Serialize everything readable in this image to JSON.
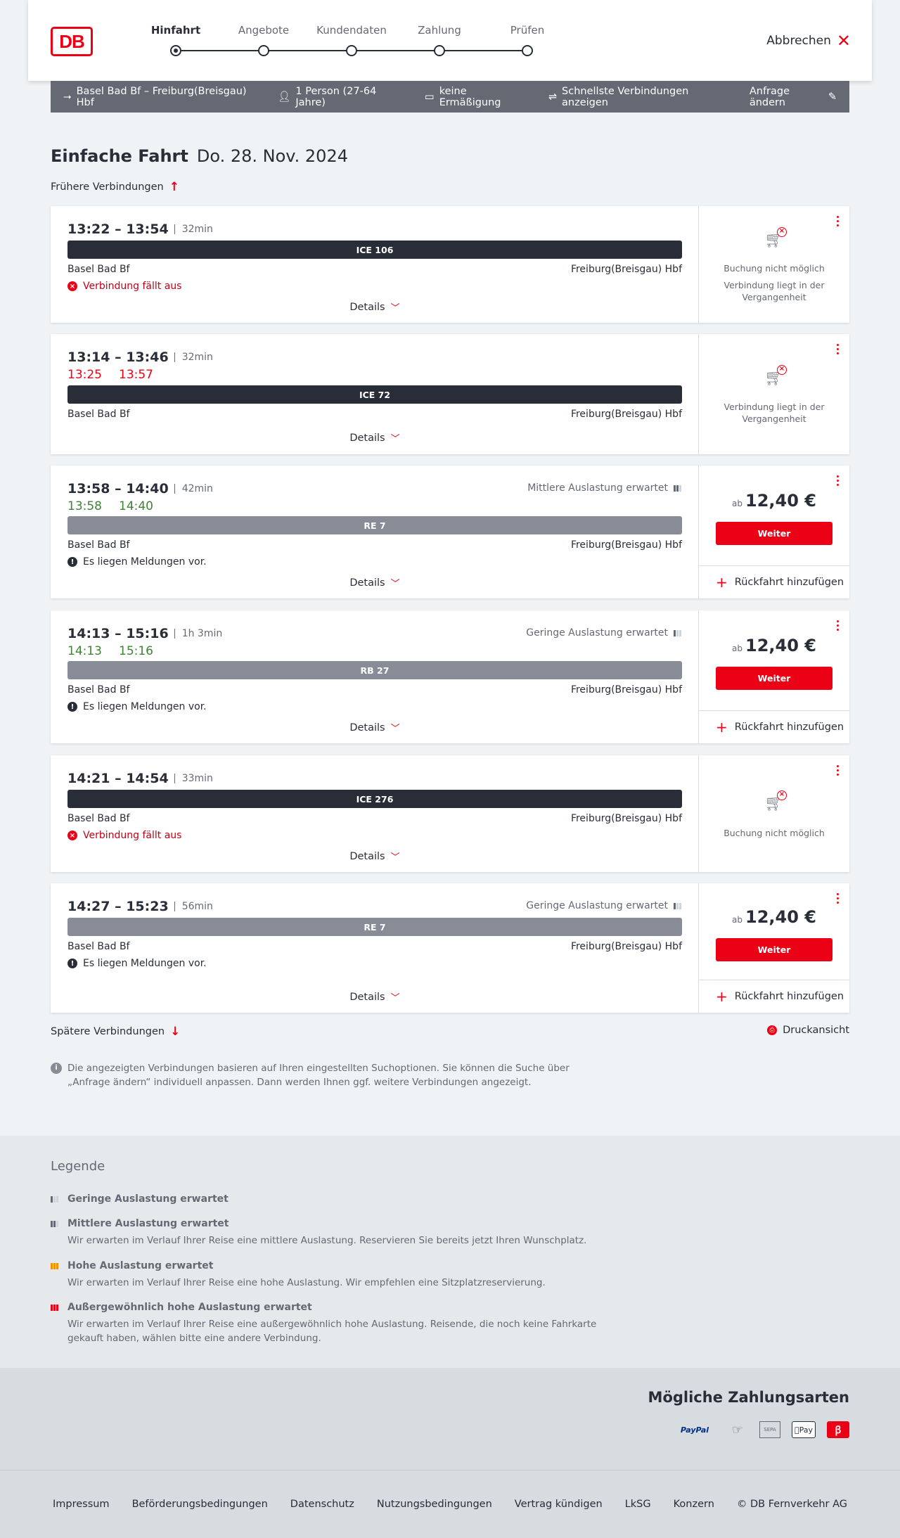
{
  "header": {
    "logo": "DB",
    "steps": [
      "Hinfahrt",
      "Angebote",
      "Kundendaten",
      "Zahlung",
      "Prüfen"
    ],
    "cancel_label": "Abbrechen"
  },
  "infobar": {
    "route": "Basel Bad Bf – Freiburg(Breisgau) Hbf",
    "passengers": "1 Person (27-64 Jahre)",
    "discount": "keine Ermäßigung",
    "fastest": "Schnellste Verbindungen anzeigen",
    "edit": "Anfrage ändern"
  },
  "main": {
    "title_bold": "Einfache Fahrt",
    "title_date": "Do. 28. Nov. 2024",
    "earlier": "Frühere Verbindungen",
    "later": "Spätere Verbindungen",
    "print": "Druckansicht",
    "note": "Die angezeigten Verbindungen basieren auf Ihren eingestellten Suchoptionen. Sie können die Suche über „Anfrage ändern“ individuell anpassen. Dann werden Ihnen ggf. weitere Verbindungen angezeigt."
  },
  "connections": [
    {
      "times": "13:22 – 13:54",
      "duration": "32min",
      "train": "ICE 106",
      "from": "Basel Bad Bf",
      "to": "Freiburg(Breisgau) Hbf",
      "message": "Verbindung fällt aus",
      "details": "Details",
      "booking": "Buchung nicht möglich",
      "past": "Verbindung liegt in der Vergangenheit"
    },
    {
      "times": "13:14 – 13:46",
      "duration": "32min",
      "rt_dep": "13:25",
      "rt_arr": "13:57",
      "train": "ICE 72",
      "from": "Basel Bad Bf",
      "to": "Freiburg(Breisgau) Hbf",
      "details": "Details",
      "past": "Verbindung liegt in der Vergangenheit"
    },
    {
      "times": "13:58 – 14:40",
      "duration": "42min",
      "rt_dep": "13:58",
      "rt_arr": "14:40",
      "train": "RE 7",
      "load": "Mittlere Auslastung erwartet",
      "from": "Basel Bad Bf",
      "to": "Freiburg(Breisgau) Hbf",
      "message": "Es liegen Meldungen vor.",
      "details": "Details",
      "price_prefix": "ab",
      "price": "12,40 €",
      "button": "Weiter",
      "return": "Rückfahrt hinzufügen"
    },
    {
      "times": "14:13 – 15:16",
      "duration": "1h 3min",
      "rt_dep": "14:13",
      "rt_arr": "15:16",
      "train": "RB 27",
      "load": "Geringe Auslastung erwartet",
      "from": "Basel Bad Bf",
      "to": "Freiburg(Breisgau) Hbf",
      "message": "Es liegen Meldungen vor.",
      "details": "Details",
      "price_prefix": "ab",
      "price": "12,40 €",
      "button": "Weiter",
      "return": "Rückfahrt hinzufügen"
    },
    {
      "times": "14:21 – 14:54",
      "duration": "33min",
      "train": "ICE 276",
      "from": "Basel Bad Bf",
      "to": "Freiburg(Breisgau) Hbf",
      "message": "Verbindung fällt aus",
      "details": "Details",
      "booking": "Buchung nicht möglich"
    },
    {
      "times": "14:27 – 15:23",
      "duration": "56min",
      "train": "RE 7",
      "load": "Geringe Auslastung erwartet",
      "from": "Basel Bad Bf",
      "to": "Freiburg(Breisgau) Hbf",
      "message": "Es liegen Meldungen vor.",
      "details": "Details",
      "price_prefix": "ab",
      "price": "12,40 €",
      "button": "Weiter",
      "return": "Rückfahrt hinzufügen"
    }
  ],
  "legend": {
    "title": "Legende",
    "items": [
      {
        "title": "Geringe Auslastung erwartet",
        "desc": ""
      },
      {
        "title": "Mittlere Auslastung erwartet",
        "desc": "Wir erwarten im Verlauf Ihrer Reise eine mittlere Auslastung. Reservieren Sie bereits jetzt Ihren Wunschplatz."
      },
      {
        "title": "Hohe Auslastung erwartet",
        "desc": "Wir erwarten im Verlauf Ihrer Reise eine hohe Auslastung. Wir empfehlen eine Sitzplatzreservierung."
      },
      {
        "title": "Außergewöhnlich hohe Auslastung erwartet",
        "desc": "Wir erwarten im Verlauf Ihrer Reise eine außergewöhnlich hohe Auslastung. Reisende, die noch keine Fahrkarte gekauft haben, wählen bitte eine andere Verbindung."
      }
    ]
  },
  "payment": {
    "title": "Mögliche Zahlungsarten",
    "paypal": "PayPal",
    "sepa": "SEPA",
    "apple": "Pay"
  },
  "footer": [
    "Impressum",
    "Beförderungsbedingungen",
    "Datenschutz",
    "Nutzungsbedingungen",
    "Vertrag kündigen",
    "LkSG",
    "Konzern",
    "© DB Fernverkehr AG"
  ],
  "colors": {
    "accent": "#ec0016",
    "dark": "#282d37",
    "green": "#408335",
    "infobar": "#646973"
  }
}
